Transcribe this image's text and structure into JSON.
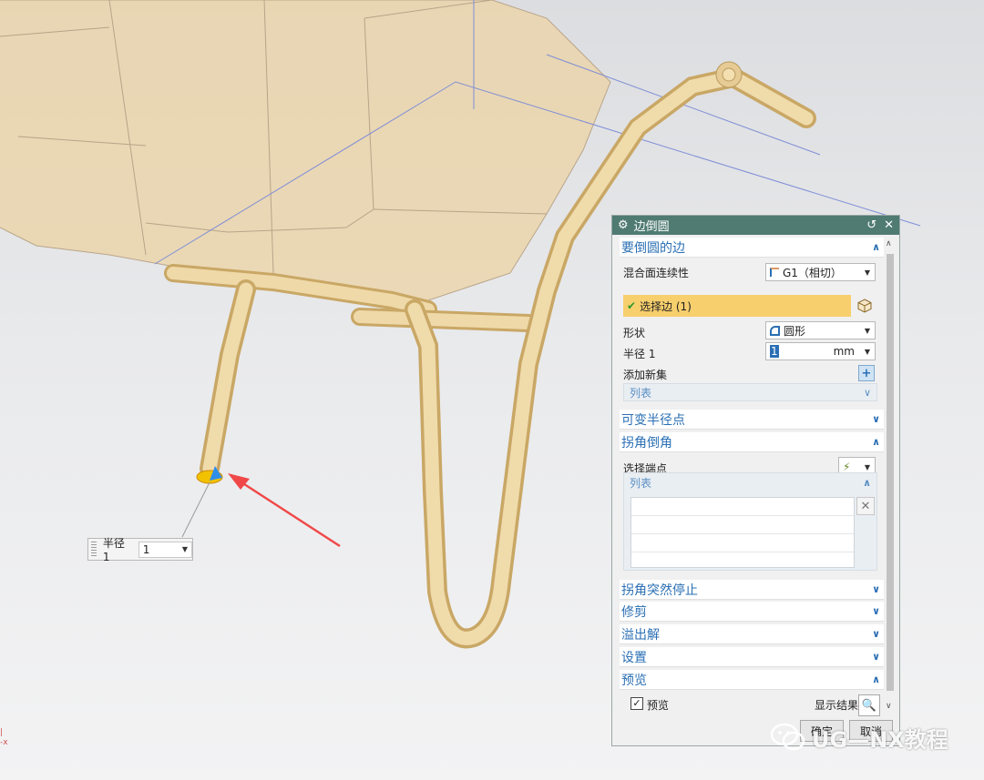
{
  "floating_field": {
    "label": "半径 1",
    "value": "1"
  },
  "dialog": {
    "title": "边倒圆",
    "sections": {
      "edges_to_blend": "要倒圆的边",
      "variable_radius": "可变半径点",
      "corner_setback": "拐角倒角",
      "corner_stop": "拐角突然停止",
      "trim": "修剪",
      "overflow": "溢出解",
      "settings": "设置",
      "preview": "预览"
    },
    "continuity": {
      "label": "混合面连续性",
      "value": "G1（相切）"
    },
    "select_edge": {
      "label": "选择边 (1)"
    },
    "shape": {
      "label": "形状",
      "value": "圆形"
    },
    "radius": {
      "label": "半径 1",
      "value": "1",
      "unit": "mm"
    },
    "add_new_set": {
      "label": "添加新集"
    },
    "list_label": "列表",
    "select_endpoint": {
      "label": "选择端点"
    },
    "corner_list_label": "列表",
    "preview": {
      "checkbox_label": "预览",
      "checked": true,
      "show_result_label": "显示结果"
    },
    "buttons": {
      "ok": "确定",
      "cancel": "取消"
    }
  },
  "watermark": {
    "text": "UG—NX教程"
  },
  "colors": {
    "titlebar": "#4f7b72",
    "selected_row": "#f7cf6d",
    "section_text": "#2a6fb4",
    "model": "#e7cb94"
  }
}
